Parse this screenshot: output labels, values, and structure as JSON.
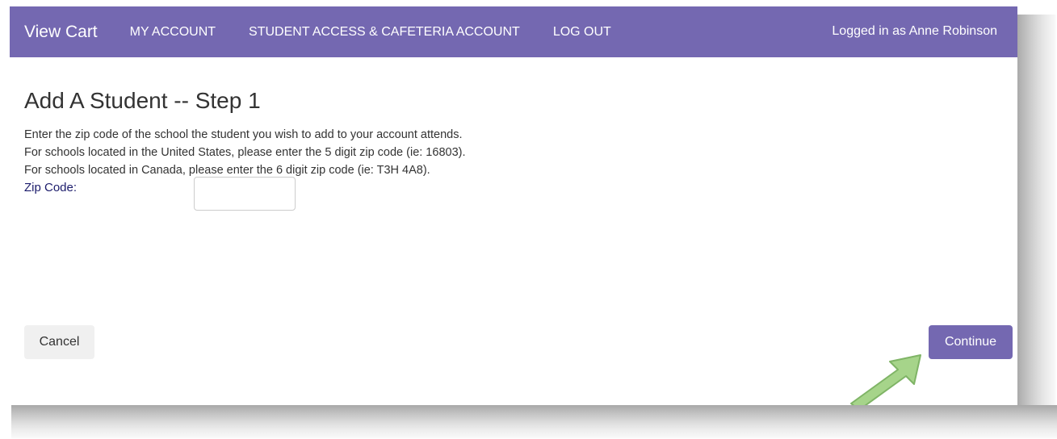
{
  "navbar": {
    "brand": "View Cart",
    "links": [
      "MY ACCOUNT",
      "STUDENT ACCESS & CAFETERIA ACCOUNT",
      "LOG OUT"
    ],
    "user_text": "Logged in as Anne Robinson",
    "color": "#7468b1"
  },
  "page": {
    "title": "Add A Student -- Step 1",
    "instructions": [
      "Enter the zip code of the school the student you wish to add to your account attends.",
      "For schools located in the United States, please enter the 5 digit zip code (ie: 16803).",
      "For schools located in Canada, please enter the 6 digit zip code (ie: T3H 4A8)."
    ]
  },
  "form": {
    "zip_label": "Zip Code:",
    "zip_value": ""
  },
  "buttons": {
    "cancel": "Cancel",
    "continue": "Continue"
  },
  "annotation": {
    "arrow_color": "#a6d48a",
    "arrow_icon": "arrow-up-right-icon"
  }
}
